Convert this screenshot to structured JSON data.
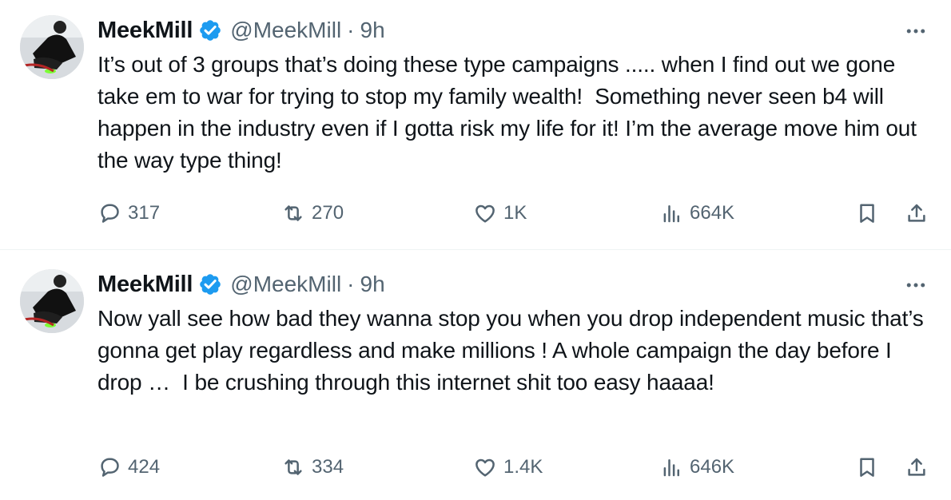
{
  "tweets": [
    {
      "display_name": "MeekMill",
      "handle": "@MeekMill",
      "separator": "·",
      "time": "9h",
      "text": "It’s out of 3 groups that’s doing these type campaigns ..... when I find out we gone take em to war for trying to stop my family wealth!  Something never seen b4 will happen in the industry even if I gotta risk my life for it! I’m the average move him out the way type thing!",
      "replies": "317",
      "reposts": "270",
      "likes": "1K",
      "views": "664K"
    },
    {
      "display_name": "MeekMill",
      "handle": "@MeekMill",
      "separator": "·",
      "time": "9h",
      "text": "Now yall see how bad they wanna stop you when you drop independent music that’s gonna get play regardless and make millions ! A whole campaign the day before I drop …  I be crushing through this internet shit too easy haaaa!",
      "replies": "424",
      "reposts": "334",
      "likes": "1.4K",
      "views": "646K"
    }
  ],
  "colors": {
    "text": "#0f1419",
    "secondary": "#536471",
    "verified": "#1d9bf0",
    "divider": "#eff3f4"
  },
  "icons": [
    "verified-badge-icon",
    "more-icon",
    "reply-icon",
    "repost-icon",
    "like-icon",
    "views-icon",
    "bookmark-icon",
    "share-icon"
  ]
}
